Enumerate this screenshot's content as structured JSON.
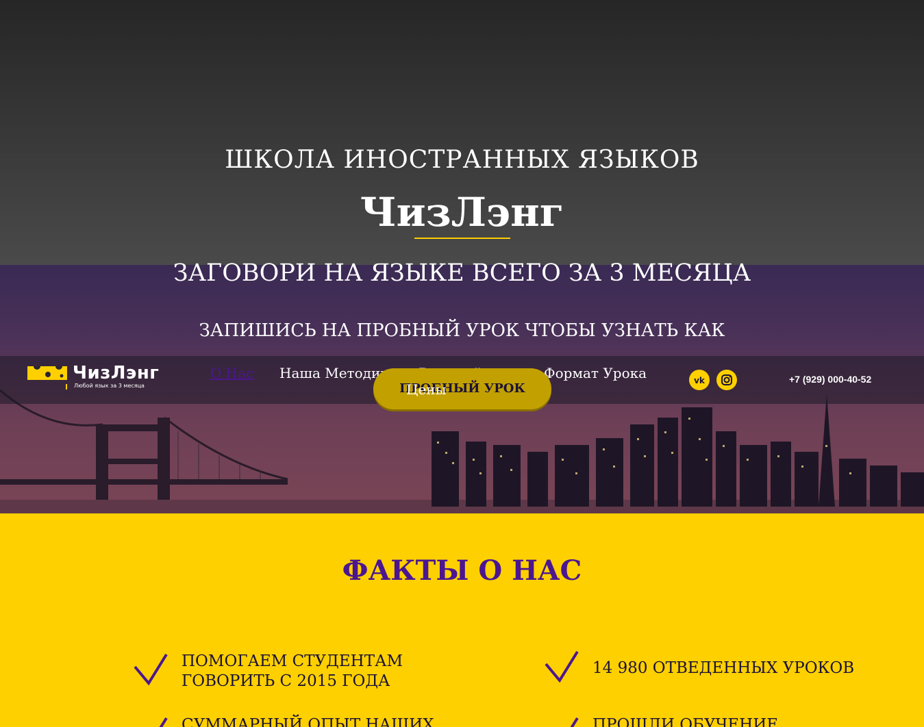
{
  "hero": {
    "subtitle": "ШКОЛА ИНОСТРАННЫХ ЯЗЫКОВ",
    "title": "ЧизЛэнг",
    "slogan": "ЗАГОВОРИ НА ЯЗЫКЕ ВСЕГО ЗА 3 МЕСЯЦА",
    "cta_text": "ЗАПИШИСЬ НА ПРОБНЫЙ УРОК ЧТОБЫ УЗНАТЬ КАК",
    "cta_button": "ПРОБНЫЙ УРОК"
  },
  "header": {
    "logo_text": "ЧизЛэнг",
    "logo_tagline": "Любой язык за 3 месяца",
    "nav": [
      {
        "label": "О Нас",
        "active": true
      },
      {
        "label": "Наша Методика"
      },
      {
        "label": "Вводный урок"
      },
      {
        "label": "Формат Урока"
      },
      {
        "label": "Цены"
      }
    ],
    "social": [
      {
        "icon": "vk-icon",
        "glyph": "vk"
      },
      {
        "icon": "instagram-icon"
      }
    ],
    "phone": "+7 (929) 000-40-52"
  },
  "facts": {
    "title": "ФАКТЫ О НАС",
    "items": [
      {
        "line1": "ПОМОГАЕМ СТУДЕНТАМ",
        "line2": "ГОВОРИТЬ С 2015 ГОДА"
      },
      {
        "line1": "14 980 ОТВЕДЕННЫХ УРОКОВ"
      },
      {
        "line1": "СУММАРНЫЙ ОПЫТ НАШИХ"
      },
      {
        "line1": "ПРОШЛИ ОБУЧЕНИЕ"
      }
    ]
  },
  "colors": {
    "accent_yellow": "#fed000",
    "accent_purple": "#4b1690"
  }
}
